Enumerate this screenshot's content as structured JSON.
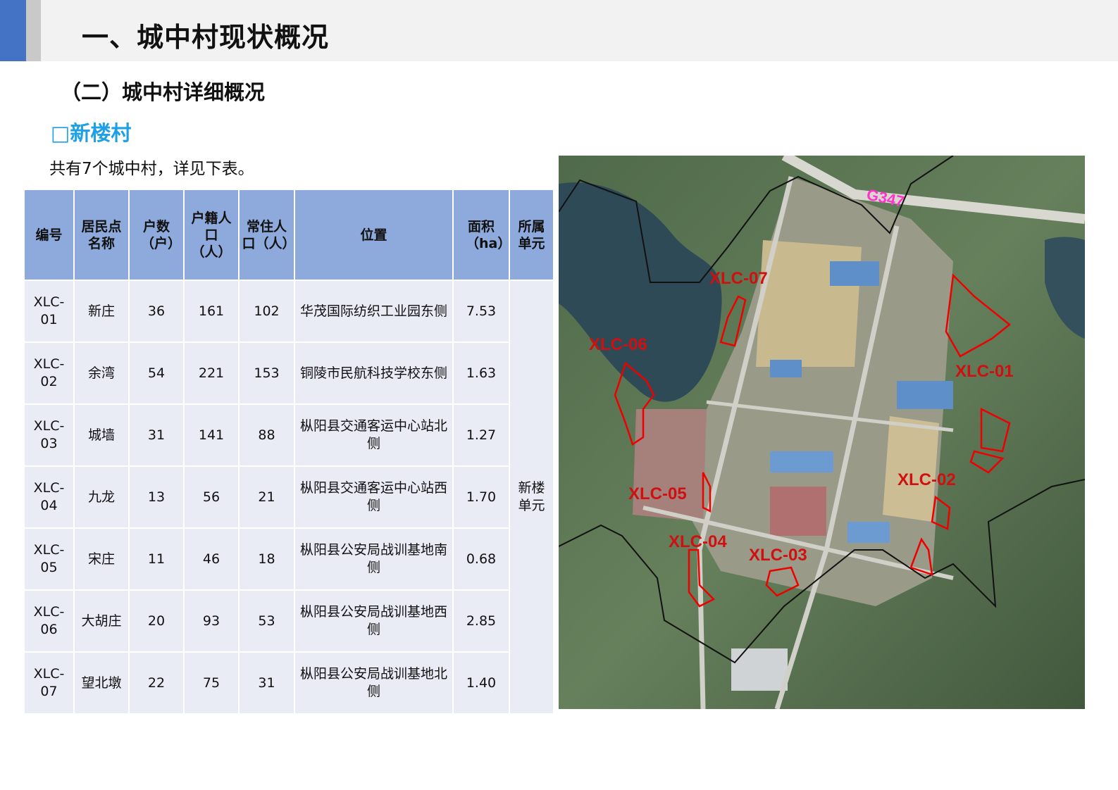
{
  "header": {
    "main_title": "一、城中村现状概况",
    "sub_title": "（二）城中村详细概况",
    "village_title": "□新楼村",
    "intro": "共有7个城中村，详见下表。"
  },
  "table": {
    "headers": [
      "编号",
      "居民点名称",
      "户数（户）",
      "户籍人口（人）",
      "常住人口（人）",
      "位置",
      "面积（ha）",
      "所属单元"
    ],
    "unit": "新楼单元",
    "rows": [
      {
        "id": "XLC-01",
        "name": "新庄",
        "households": "36",
        "registered": "161",
        "resident": "102",
        "location": "华茂国际纺织工业园东侧",
        "area": "7.53"
      },
      {
        "id": "XLC-02",
        "name": "余湾",
        "households": "54",
        "registered": "221",
        "resident": "153",
        "location": "铜陵市民航科技学校东侧",
        "area": "1.63"
      },
      {
        "id": "XLC-03",
        "name": "城墙",
        "households": "31",
        "registered": "141",
        "resident": "88",
        "location": "枞阳县交通客运中心站北侧",
        "area": "1.27"
      },
      {
        "id": "XLC-04",
        "name": "九龙",
        "households": "13",
        "registered": "56",
        "resident": "21",
        "location": "枞阳县交通客运中心站西侧",
        "area": "1.70"
      },
      {
        "id": "XLC-05",
        "name": "宋庄",
        "households": "11",
        "registered": "46",
        "resident": "18",
        "location": "枞阳县公安局战训基地南侧",
        "area": "0.68"
      },
      {
        "id": "XLC-06",
        "name": "大胡庄",
        "households": "20",
        "registered": "93",
        "resident": "53",
        "location": "枞阳县公安局战训基地西侧",
        "area": "2.85"
      },
      {
        "id": "XLC-07",
        "name": "望北墩",
        "households": "22",
        "registered": "75",
        "resident": "31",
        "location": "枞阳县公安局战训基地北侧",
        "area": "1.40"
      }
    ]
  },
  "map": {
    "road_label": "G347",
    "labels": [
      "XLC-07",
      "XLC-06",
      "XLC-01",
      "XLC-05",
      "XLC-02",
      "XLC-04",
      "XLC-03"
    ],
    "colors": {
      "label": "#d01010",
      "road_label": "#ff33cc",
      "boundary": "#ee0000"
    }
  }
}
